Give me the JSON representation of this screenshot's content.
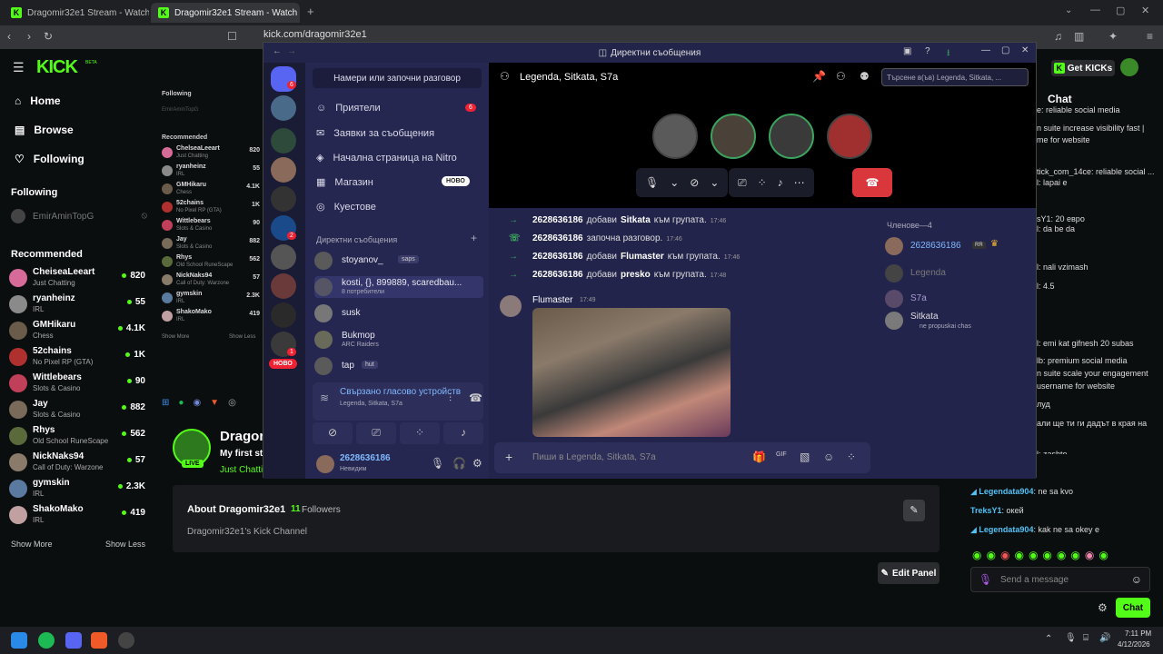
{
  "browser": {
    "tabs": [
      {
        "label": "Dragomir32e1 Stream - Watch Live o"
      },
      {
        "label": "Dragomir32e1 Stream - Watch L"
      }
    ],
    "url": "kick.com/dragomir32e1"
  },
  "kick": {
    "logo": "KICK",
    "logo_beta": "BETA",
    "nav": [
      {
        "label": "Home",
        "icon": "home-icon"
      },
      {
        "label": "Browse",
        "icon": "browse-icon"
      },
      {
        "label": "Following",
        "icon": "heart-icon"
      }
    ],
    "following_heading": "Following",
    "following_user": "EmirAminTopG",
    "recommended_heading": "Recommended",
    "recommended": [
      {
        "name": "CheiseaLeeart",
        "category": "Just Chatting",
        "count": "820",
        "color": "#d66b9a"
      },
      {
        "name": "ryanheinz",
        "category": "IRL",
        "count": "55",
        "color": "#8a8a8a"
      },
      {
        "name": "GMHikaru",
        "category": "Chess",
        "count": "4.1K",
        "color": "#6b5b4b"
      },
      {
        "name": "52chains",
        "category": "No Pixel RP (GTA)",
        "count": "1K",
        "color": "#b03030"
      },
      {
        "name": "Wittlebears",
        "category": "Slots & Casino",
        "count": "90",
        "color": "#c0405a"
      },
      {
        "name": "Jay",
        "category": "Slots & Casino",
        "count": "882",
        "color": "#7a6a5a"
      },
      {
        "name": "Rhys",
        "category": "Old School RuneScape",
        "count": "562",
        "color": "#5a6a3a"
      },
      {
        "name": "NickNaks94",
        "category": "Call of Duty: Warzone",
        "count": "57",
        "color": "#8a7a6a"
      },
      {
        "name": "gymskin",
        "category": "IRL",
        "count": "2.3K",
        "color": "#5a7aa0"
      },
      {
        "name": "ShakoMako",
        "category": "IRL",
        "count": "419",
        "color": "#c0a0a0"
      }
    ],
    "show_more": "Show More",
    "show_less": "Show Less",
    "get_kicks": "Get KICKs",
    "chat_heading": "Chat",
    "channel_name": "Dragon",
    "channel_title": "My first st",
    "channel_category": "Just Chatti",
    "live_badge": "LIVE",
    "about_title": "About Dragomir32e1",
    "followers_count": "11",
    "followers_label": "Followers",
    "about_desc": "Dragomir32e1's Kick Channel",
    "edit_panel": "Edit Panel",
    "chat_lines": [
      "e: reliable social media",
      "n suite increase visibility fast |",
      "me for website",
      "tick_com_14ce: reliable social ...",
      "l: lapai e",
      "sY1: 20 евро",
      "l: da be da",
      "l: nali vzimash",
      "l: 4.5",
      "l: emi kat gifnesh 20 subas",
      "lb: premium social media",
      "n suite scale your engagement",
      "username for website",
      "луд",
      "али ще ти ги дадът в края на",
      "l: zashto",
      "ca олей"
    ],
    "chat_bottom": [
      {
        "user": "Legendata904",
        "text": ": ne sa kvo",
        "color": "#4fc3f7"
      },
      {
        "user": "TreksY1",
        "text": ": окей",
        "color": "#4fc3f7"
      },
      {
        "user": "Legendata904",
        "text": ": kak ne sa okey e",
        "color": "#4fc3f7"
      }
    ],
    "send_placeholder": "Send a message",
    "chat_button": "Chat"
  },
  "sidebar2": {
    "following_heading": "Following",
    "following_user": "EmirAminTopG",
    "recommended_heading": "Recommended",
    "rows": [
      {
        "name": "ChelseaLeeart",
        "cat": "Just Chatting",
        "v": "820"
      },
      {
        "name": "ryanheinz",
        "cat": "IRL",
        "v": "55"
      },
      {
        "name": "GMHikaru",
        "cat": "Chess",
        "v": "4.1K"
      },
      {
        "name": "52chains",
        "cat": "No Pixel RP (GTA)",
        "v": "1K"
      },
      {
        "name": "Wittlebears",
        "cat": "Slots & Casino",
        "v": "90"
      },
      {
        "name": "Jay",
        "cat": "Slots & Casino",
        "v": "882"
      },
      {
        "name": "Rhys",
        "cat": "Old School RuneScape",
        "v": "562"
      },
      {
        "name": "NickNaks94",
        "cat": "Call of Duty: Warzone",
        "v": "57"
      },
      {
        "name": "gymskin",
        "cat": "IRL",
        "v": "2.3K"
      },
      {
        "name": "ShakoMako",
        "cat": "IRL",
        "v": "419"
      }
    ],
    "show_more": "Show More",
    "show_less": "Show Less"
  },
  "discord": {
    "window_title": "Директни съобщения",
    "find_conversation": "Намери или започни разговор",
    "menu": [
      {
        "label": "Приятели",
        "badge": "6"
      },
      {
        "label": "Заявки за съобщения"
      },
      {
        "label": "Начална страница на Nitro"
      },
      {
        "label": "Магазин",
        "tag": "НОВО"
      },
      {
        "label": "Куестове"
      }
    ],
    "dm_heading": "Директни съобщения",
    "dms": [
      {
        "name": "stoyanov_",
        "sub": "",
        "tag": "saps"
      },
      {
        "name": "kosti, {}, 899889, scaredbau...",
        "sub": "8 потребители",
        "tag": ""
      },
      {
        "name": "susk",
        "sub": "",
        "tag": ""
      },
      {
        "name": "Bukmop",
        "sub": "ARC Raiders",
        "tag": ""
      },
      {
        "name": "tap",
        "sub": "",
        "tag": "hut"
      }
    ],
    "guild_new": "НОВО",
    "guild_badges": [
      "6",
      "2",
      "1"
    ],
    "voice_connected": "Свързано гласово устройств",
    "voice_sub": "Legenda, Sitkata, S7a",
    "user_name": "2628636186",
    "user_status": "Невидим",
    "channel_header": "Legenda, Sitkata, S7a",
    "search_placeholder": "Търсене в(ъв) Legenda, Sitkata, ...",
    "system_messages": [
      {
        "user": "2628636186",
        "mid": "добави",
        "target": "Sitkata",
        "end": "към групата.",
        "time": "17:46"
      },
      {
        "user": "2628636186",
        "mid": "започна разговор.",
        "target": "",
        "end": "",
        "time": "17:46"
      },
      {
        "user": "2628636186",
        "mid": "добави",
        "target": "Flumaster",
        "end": "към групата.",
        "time": "17:46"
      },
      {
        "user": "2628636186",
        "mid": "добави",
        "target": "presko",
        "end": "към групата.",
        "time": "17:48"
      }
    ],
    "message_author": "Flumaster",
    "message_time": "17:49",
    "message_placeholder": "Пиши в Legenda, Sitkata, S7a",
    "members_heading": "Членове—4",
    "members": [
      {
        "name": "2628636186",
        "sub": "",
        "tag": "RR"
      },
      {
        "name": "Legenda",
        "sub": ""
      },
      {
        "name": "S7a",
        "sub": ""
      },
      {
        "name": "Sitkata",
        "sub": "ne propuskai chas"
      }
    ]
  },
  "taskbar": {
    "time": "7:11 PM",
    "date": "4/12/2026"
  }
}
